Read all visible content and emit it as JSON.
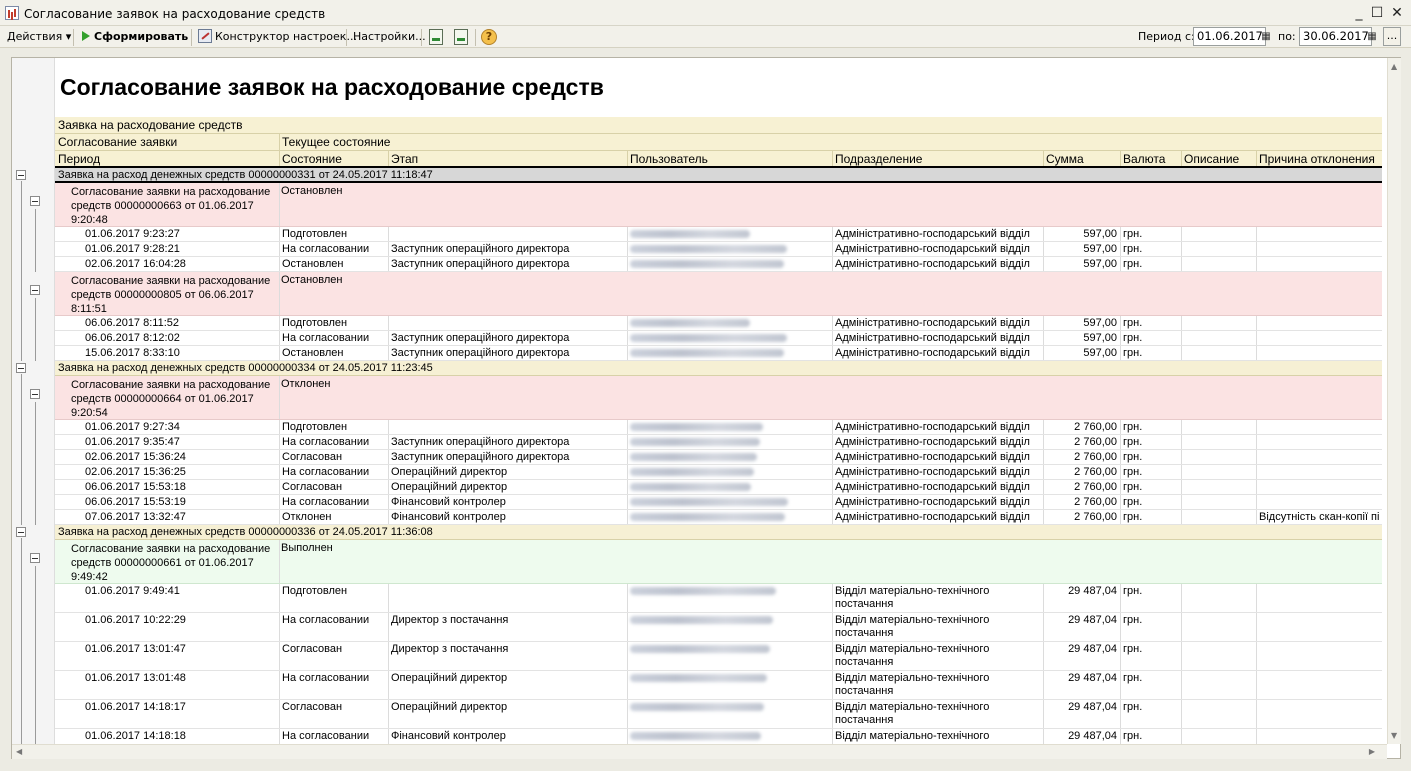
{
  "window": {
    "title": "Согласование заявок на расходование средств"
  },
  "toolbar": {
    "actions": "Действия",
    "generate": "Сформировать",
    "constructor": "Конструктор настроек...",
    "settings": "Настройки...",
    "period_from_label": "Период с:",
    "period_from": "01.06.2017",
    "period_to_label": "по:",
    "period_to": "30.06.2017",
    "dots": "..."
  },
  "report": {
    "title": "Согласование заявок на расходование средств",
    "header": {
      "level1": "Заявка на расходование средств",
      "level2a": "Согласование заявки",
      "level2b": "Текущее состояние",
      "columns": [
        "Период",
        "Состояние",
        "Этап",
        "Пользователь",
        "Подразделение",
        "Сумма",
        "Валюта",
        "Описание",
        "Причина отклонения"
      ]
    },
    "groups": [
      {
        "title": "Заявка на расход денежных средств 00000000331 от 24.05.2017 11:18:47",
        "subs": [
          {
            "desc": "Согласование заявки на расходование средств 00000000663 от 01.06.2017 9:20:48",
            "state": "Остановлен",
            "rows": [
              [
                "01.06.2017 9:23:27",
                "Подготовлен",
                "",
                "Адміністративно-господарський відділ",
                "597,00",
                "грн.",
                "",
                ""
              ],
              [
                "01.06.2017 9:28:21",
                "На согласовании",
                "Заступник операційного директора",
                "Адміністративно-господарський відділ",
                "597,00",
                "грн.",
                "",
                ""
              ],
              [
                "02.06.2017 16:04:28",
                "Остановлен",
                "Заступник операційного директора",
                "Адміністративно-господарський відділ",
                "597,00",
                "грн.",
                "",
                ""
              ]
            ]
          },
          {
            "desc": "Согласование заявки на расходование средств 00000000805 от 06.06.2017 8:11:51",
            "state": "Остановлен",
            "rows": [
              [
                "06.06.2017 8:11:52",
                "Подготовлен",
                "",
                "Адміністративно-господарський відділ",
                "597,00",
                "грн.",
                "",
                ""
              ],
              [
                "06.06.2017 8:12:02",
                "На согласовании",
                "Заступник операційного директора",
                "Адміністративно-господарський відділ",
                "597,00",
                "грн.",
                "",
                ""
              ],
              [
                "15.06.2017 8:33:10",
                "Остановлен",
                "Заступник операційного директора",
                "Адміністративно-господарський відділ",
                "597,00",
                "грн.",
                "",
                ""
              ]
            ]
          }
        ]
      },
      {
        "title": "Заявка на расход денежных средств 00000000334 от 24.05.2017 11:23:45",
        "subs": [
          {
            "desc": "Согласование заявки на расходование средств 00000000664 от 01.06.2017 9:20:54",
            "state": "Отклонен",
            "rows": [
              [
                "01.06.2017 9:27:34",
                "Подготовлен",
                "",
                "Адміністративно-господарський відділ",
                "2 760,00",
                "грн.",
                "",
                ""
              ],
              [
                "01.06.2017 9:35:47",
                "На согласовании",
                "Заступник операційного директора",
                "Адміністративно-господарський відділ",
                "2 760,00",
                "грн.",
                "",
                ""
              ],
              [
                "02.06.2017 15:36:24",
                "Согласован",
                "Заступник операційного директора",
                "Адміністративно-господарський відділ",
                "2 760,00",
                "грн.",
                "",
                ""
              ],
              [
                "02.06.2017 15:36:25",
                "На согласовании",
                "Операційний директор",
                "Адміністративно-господарський відділ",
                "2 760,00",
                "грн.",
                "",
                ""
              ],
              [
                "06.06.2017 15:53:18",
                "Согласован",
                "Операційний директор",
                "Адміністративно-господарський відділ",
                "2 760,00",
                "грн.",
                "",
                ""
              ],
              [
                "06.06.2017 15:53:19",
                "На согласовании",
                "Фінансовий контролер",
                "Адміністративно-господарський відділ",
                "2 760,00",
                "грн.",
                "",
                ""
              ],
              [
                "07.06.2017 13:32:47",
                "Отклонен",
                "Фінансовий контролер",
                "Адміністративно-господарський відділ",
                "2 760,00",
                "грн.",
                "",
                "Відсутність скан-копії пі"
              ]
            ]
          }
        ]
      },
      {
        "title": "Заявка на расход денежных средств 00000000336 от 24.05.2017 11:36:08",
        "subs": [
          {
            "desc": "Согласование заявки на расходование средств 00000000661 от 01.06.2017 9:49:42",
            "state": "Выполнен",
            "rows": [
              [
                "01.06.2017 9:49:41",
                "Подготовлен",
                "",
                "Відділ матеріально-технічного постачання",
                "29 487,04",
                "грн.",
                "",
                ""
              ],
              [
                "01.06.2017 10:22:29",
                "На согласовании",
                "Директор з постачання",
                "Відділ матеріально-технічного постачання",
                "29 487,04",
                "грн.",
                "",
                ""
              ],
              [
                "01.06.2017 13:01:47",
                "Согласован",
                "Директор з постачання",
                "Відділ матеріально-технічного постачання",
                "29 487,04",
                "грн.",
                "",
                ""
              ],
              [
                "01.06.2017 13:01:48",
                "На согласовании",
                "Операційний директор",
                "Відділ матеріально-технічного постачання",
                "29 487,04",
                "грн.",
                "",
                ""
              ],
              [
                "01.06.2017 14:18:17",
                "Согласован",
                "Операційний директор",
                "Відділ матеріально-технічного постачання",
                "29 487,04",
                "грн.",
                "",
                ""
              ],
              [
                "01.06.2017 14:18:18",
                "На согласовании",
                "Фінансовий контролер",
                "Відділ матеріально-технічного постачання",
                "29 487,04",
                "грн.",
                "",
                ""
              ]
            ]
          }
        ]
      }
    ]
  }
}
